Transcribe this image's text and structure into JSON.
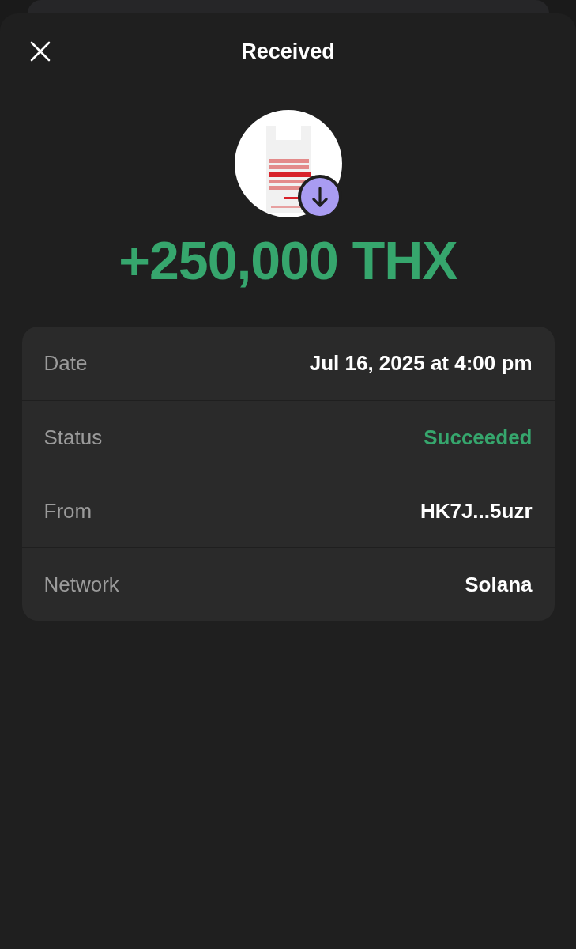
{
  "header": {
    "title": "Received"
  },
  "amount": "+250,000 THX",
  "details": [
    {
      "label": "Date",
      "value": "Jul 16, 2025 at 4:00 pm",
      "kind": "plain"
    },
    {
      "label": "Status",
      "value": "Succeeded",
      "kind": "status"
    },
    {
      "label": "From",
      "value": "HK7J...5uzr",
      "kind": "plain"
    },
    {
      "label": "Network",
      "value": "Solana",
      "kind": "plain"
    }
  ]
}
